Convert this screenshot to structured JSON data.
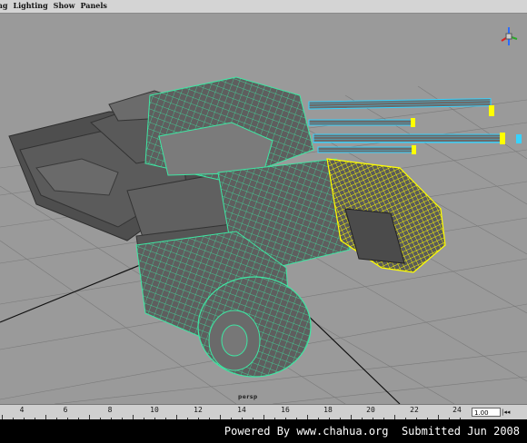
{
  "menubar": {
    "items": [
      "ing",
      "Lighting",
      "Show",
      "Panels"
    ]
  },
  "viewport": {
    "camera_label": "persp"
  },
  "timeline": {
    "ticks": [
      "4",
      "6",
      "8",
      "10",
      "12",
      "14",
      "16",
      "18",
      "20",
      "22",
      "24"
    ],
    "current_frame": "1.00",
    "controls": "|◂◂"
  },
  "footer": {
    "text": "Powered By www.chahua.org  Submitted Jun 2008"
  },
  "colors": {
    "wire_green": "#39e0a0",
    "wire_cyan": "#36d6ff",
    "wire_yellow": "#ffff00",
    "mesh_gray": "#5a5a5a",
    "viewport_bg": "#9a9a9a"
  }
}
